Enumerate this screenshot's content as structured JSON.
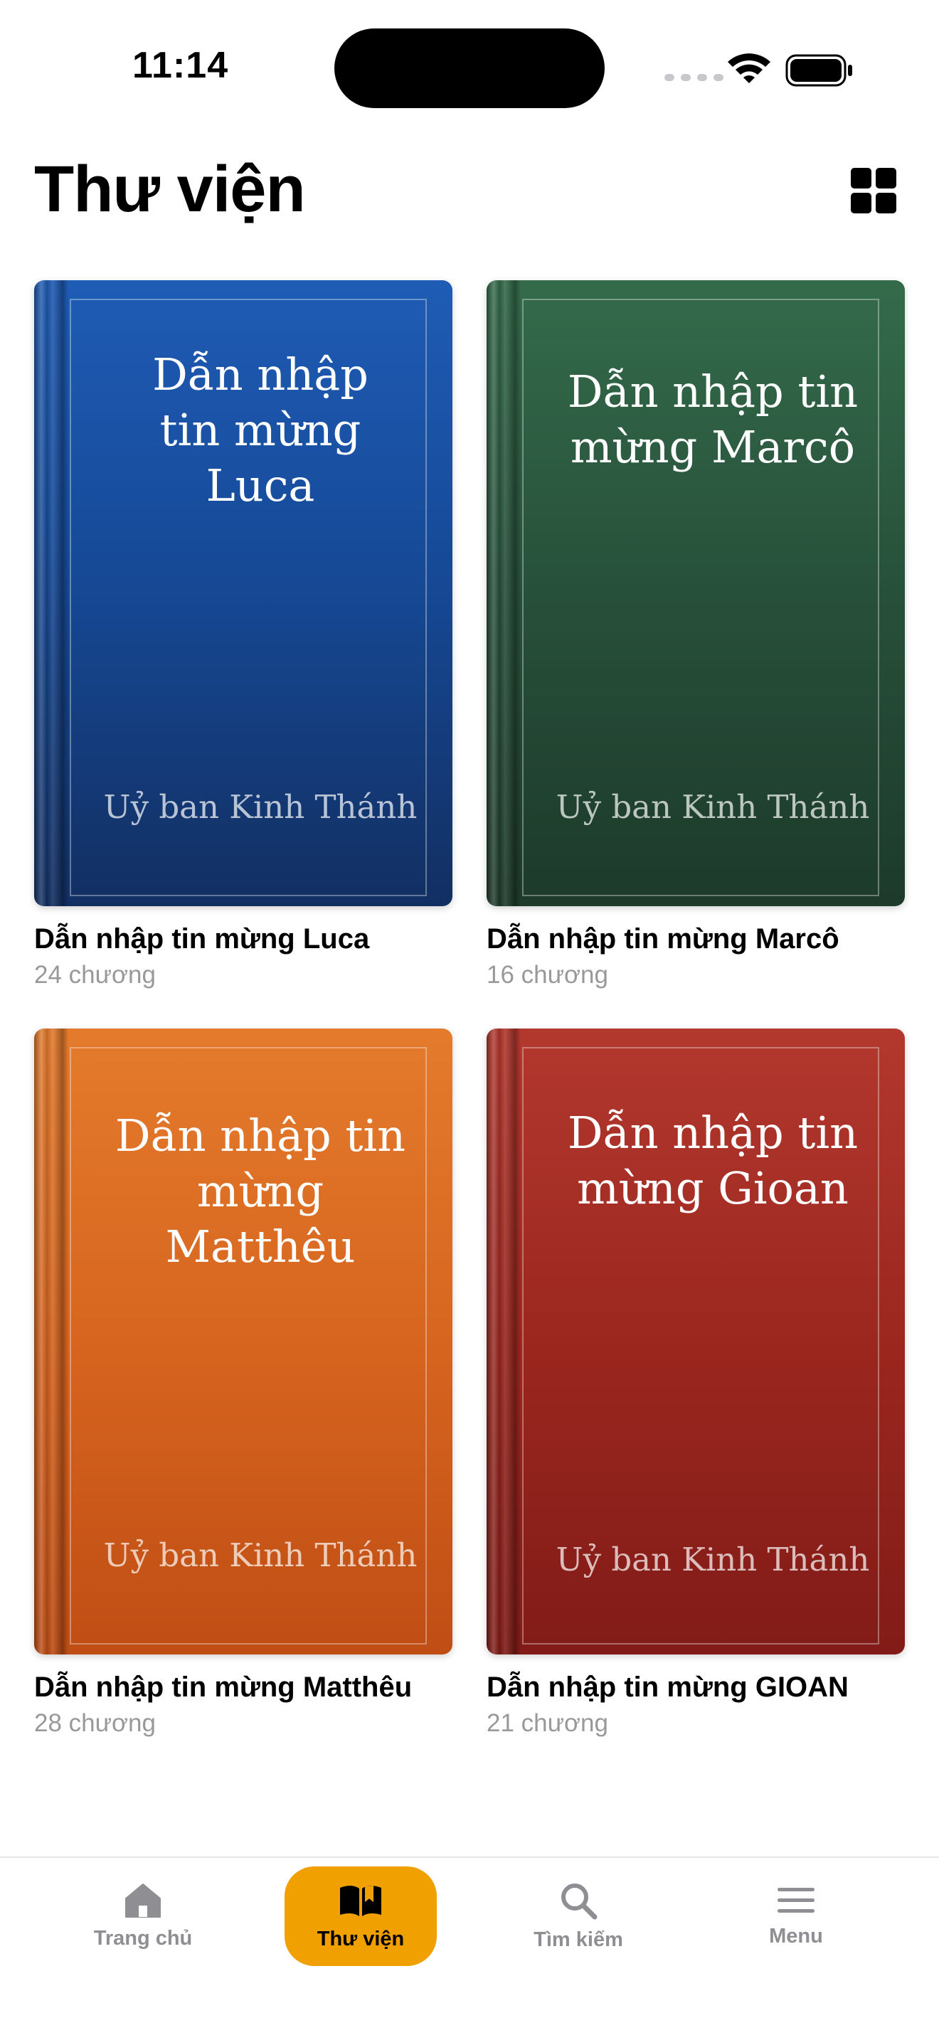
{
  "status_bar": {
    "time": "11:14"
  },
  "header": {
    "title": "Thư viện",
    "view_toggle_icon": "grid-icon"
  },
  "books": [
    {
      "cover_title": "Dẫn nhập tin mừng Luca",
      "cover_author": "Uỷ ban Kinh Thánh",
      "title": "Dẫn nhập tin mừng Luca",
      "chapters": "24 chương",
      "color": "#1a4fa0"
    },
    {
      "cover_title": "Dẫn nhập tin mừng Marcô",
      "cover_author": "Uỷ ban Kinh Thánh",
      "title": "Dẫn nhập tin mừng Marcô",
      "chapters": "16 chương",
      "color": "#2b5a3f"
    },
    {
      "cover_title": "Dẫn nhập tin mừng Matthêu",
      "cover_author": "Uỷ ban Kinh Thánh",
      "title": "Dẫn nhập tin mừng Matthêu",
      "chapters": "28 chương",
      "color": "#d9661f"
    },
    {
      "cover_title": "Dẫn nhập tin mừng Gioan",
      "cover_author": "Uỷ ban Kinh Thánh",
      "title": "Dẫn nhập tin mừng GIOAN",
      "chapters": "21 chương",
      "color": "#9e2a22"
    }
  ],
  "tabbar": {
    "accent": "#f0a000",
    "tabs": [
      {
        "label": "Trang chủ",
        "icon": "home-icon",
        "active": false
      },
      {
        "label": "Thư viện",
        "icon": "book-icon",
        "active": true
      },
      {
        "label": "Tìm kiếm",
        "icon": "search-icon",
        "active": false
      },
      {
        "label": "Menu",
        "icon": "menu-icon",
        "active": false
      }
    ]
  }
}
